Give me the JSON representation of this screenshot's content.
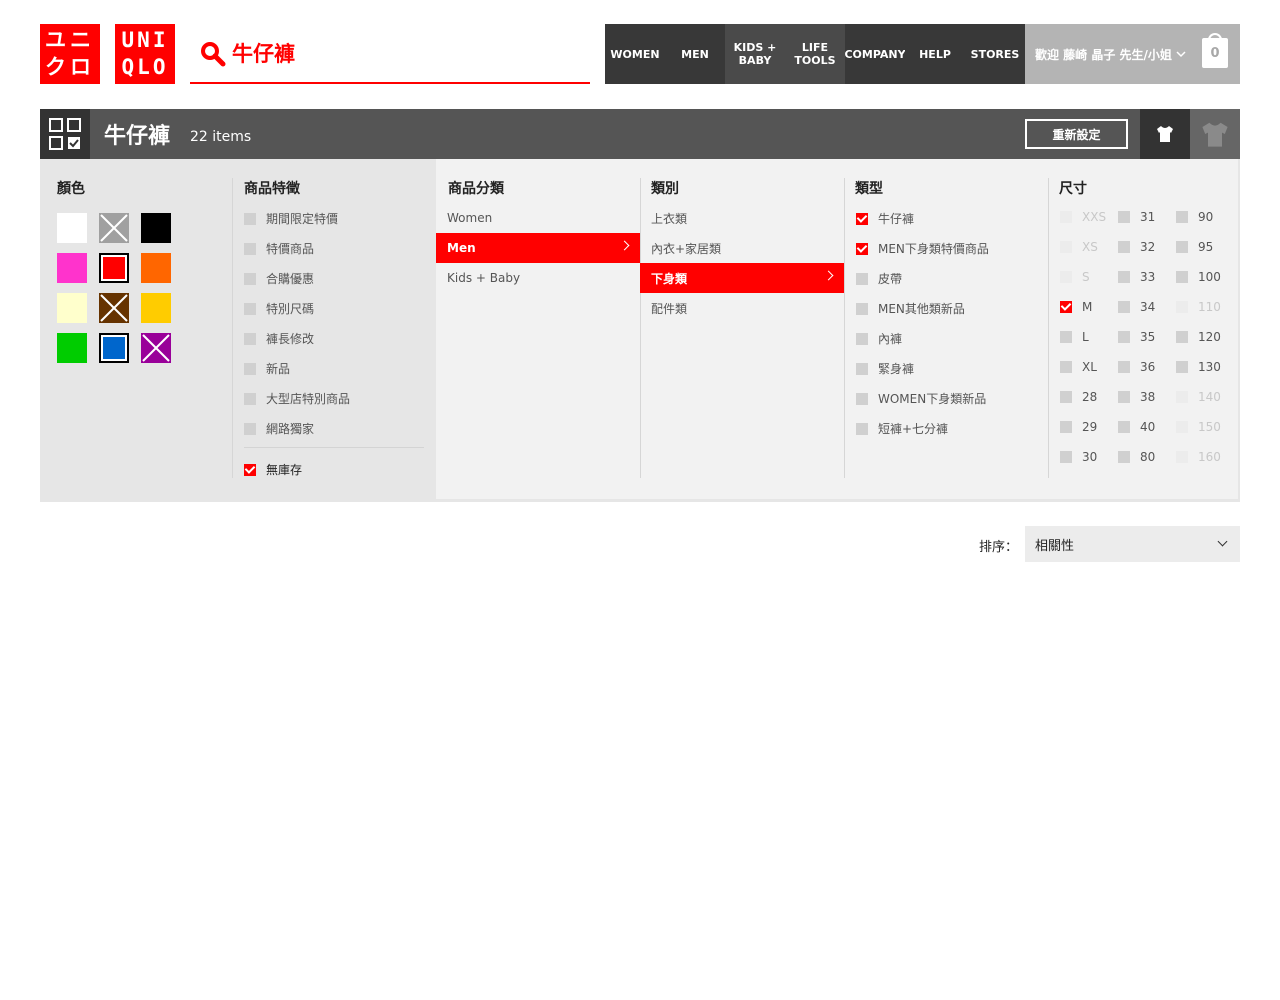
{
  "header": {
    "logo_jp": [
      "ユニ",
      "クロ"
    ],
    "logo_en": [
      "UNI",
      "QLO"
    ],
    "search_value": "牛仔褲",
    "nav": [
      {
        "label": "WOMEN"
      },
      {
        "label": "MEN"
      },
      {
        "label": "KIDS +\nBABY"
      },
      {
        "label": "LIFE\nTOOLS"
      },
      {
        "label": "COMPANY"
      },
      {
        "label": "HELP"
      },
      {
        "label": "STORES"
      }
    ],
    "account_label": "歡迎 藤崎 晶子 先生/小姐",
    "bag_count": "0"
  },
  "filter_bar": {
    "title": "牛仔褲",
    "count": "22 items",
    "reset_label": "重新設定"
  },
  "filters": {
    "color": {
      "title": "顏色",
      "swatches": [
        {
          "name": "white",
          "color": "#ffffff",
          "state": "normal"
        },
        {
          "name": "gray",
          "color": "#a0a0a0",
          "state": "unavailable"
        },
        {
          "name": "black",
          "color": "#000000",
          "state": "normal"
        },
        {
          "name": "pink",
          "color": "#ff33cc",
          "state": "normal"
        },
        {
          "name": "red",
          "color": "#ff0000",
          "state": "selected"
        },
        {
          "name": "orange",
          "color": "#ff6600",
          "state": "normal"
        },
        {
          "name": "cream",
          "color": "#ffffcc",
          "state": "normal"
        },
        {
          "name": "brown",
          "color": "#663300",
          "state": "unavailable"
        },
        {
          "name": "yellow",
          "color": "#ffcc00",
          "state": "normal"
        },
        {
          "name": "green",
          "color": "#00cc00",
          "state": "normal"
        },
        {
          "name": "blue",
          "color": "#0066cc",
          "state": "selected"
        },
        {
          "name": "purple",
          "color": "#990099",
          "state": "unavailable"
        }
      ]
    },
    "features": {
      "title": "商品特徵",
      "items": [
        {
          "label": "期間限定特價",
          "checked": false
        },
        {
          "label": "特價商品",
          "checked": false
        },
        {
          "label": "合購優惠",
          "checked": false
        },
        {
          "label": "特別尺碼",
          "checked": false
        },
        {
          "label": "褲長修改",
          "checked": false
        },
        {
          "label": "新品",
          "checked": false
        },
        {
          "label": "大型店特別商品",
          "checked": false
        },
        {
          "label": "網路獨家",
          "checked": false
        }
      ],
      "out_of_stock": {
        "label": "無庫存",
        "checked": true
      }
    },
    "category": {
      "title": "商品分類",
      "items": [
        {
          "label": "Women",
          "active": false
        },
        {
          "label": "Men",
          "active": true
        },
        {
          "label": "Kids + Baby",
          "active": false
        }
      ]
    },
    "subcategory": {
      "title": "類別",
      "items": [
        {
          "label": "上衣類",
          "active": false
        },
        {
          "label": "內衣+家居類",
          "active": false
        },
        {
          "label": "下身類",
          "active": true
        },
        {
          "label": "配件類",
          "active": false
        }
      ]
    },
    "type": {
      "title": "類型",
      "items": [
        {
          "label": "牛仔褲",
          "checked": true
        },
        {
          "label": "MEN下身類特價商品",
          "checked": true
        },
        {
          "label": "皮帶",
          "checked": false
        },
        {
          "label": "MEN其他類新品",
          "checked": false
        },
        {
          "label": "內褲",
          "checked": false
        },
        {
          "label": "緊身褲",
          "checked": false
        },
        {
          "label": "WOMEN下身類新品",
          "checked": false
        },
        {
          "label": "短褲+七分褲",
          "checked": false
        }
      ]
    },
    "size": {
      "title": "尺寸",
      "columns": [
        [
          {
            "label": "XXS",
            "state": "disabled"
          },
          {
            "label": "XS",
            "state": "disabled"
          },
          {
            "label": "S",
            "state": "disabled"
          },
          {
            "label": "M",
            "state": "checked"
          },
          {
            "label": "L",
            "state": "normal"
          },
          {
            "label": "XL",
            "state": "normal"
          },
          {
            "label": "28",
            "state": "normal"
          },
          {
            "label": "29",
            "state": "normal"
          },
          {
            "label": "30",
            "state": "normal"
          }
        ],
        [
          {
            "label": "31",
            "state": "normal"
          },
          {
            "label": "32",
            "state": "normal"
          },
          {
            "label": "33",
            "state": "normal"
          },
          {
            "label": "34",
            "state": "normal"
          },
          {
            "label": "35",
            "state": "normal"
          },
          {
            "label": "36",
            "state": "normal"
          },
          {
            "label": "38",
            "state": "normal"
          },
          {
            "label": "40",
            "state": "normal"
          },
          {
            "label": "80",
            "state": "normal"
          }
        ],
        [
          {
            "label": "90",
            "state": "normal"
          },
          {
            "label": "95",
            "state": "normal"
          },
          {
            "label": "100",
            "state": "normal"
          },
          {
            "label": "110",
            "state": "disabled"
          },
          {
            "label": "120",
            "state": "normal"
          },
          {
            "label": "130",
            "state": "normal"
          },
          {
            "label": "140",
            "state": "disabled"
          },
          {
            "label": "150",
            "state": "disabled"
          },
          {
            "label": "160",
            "state": "disabled"
          }
        ]
      ]
    }
  },
  "sort": {
    "label": "排序：",
    "selected": "相關性"
  },
  "colors": {
    "brand_red": "#ff0000",
    "dark_bar": "#555555",
    "panel_bg": "#e6e6e6"
  }
}
